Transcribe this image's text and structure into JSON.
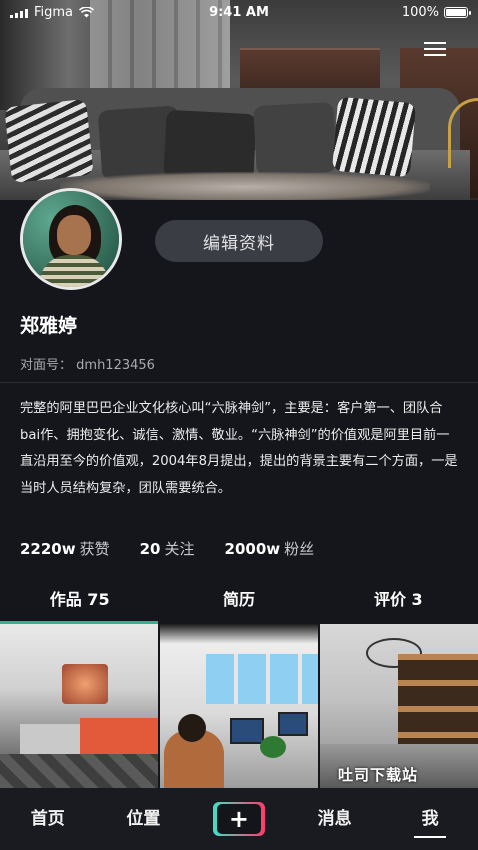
{
  "status_bar": {
    "carrier": "Figma",
    "time": "9:41 AM",
    "battery_text": "100%",
    "battery_level": 1.0
  },
  "profile": {
    "edit_button_label": "编辑资料",
    "name": "郑雅婷",
    "account_label": "对面号：",
    "account_id": "dmh123456",
    "bio": "完整的阿里巴巴企业文化核心叫“六脉神剑”，主要是：客户第一、团队合bai作、拥抱变化、诚信、激情、敬业。“六脉神剑”的价值观是阿里目前一直沿用至今的价值观，2004年8月提出，提出的背景主要有二个方面，一是当时人员结构复杂，团队需要统合。"
  },
  "stats": [
    {
      "value": "2220w",
      "label": "获赞"
    },
    {
      "value": "20",
      "label": "关注"
    },
    {
      "value": "2000w",
      "label": "粉丝"
    }
  ],
  "tabs": [
    {
      "label": "作品 75",
      "active": true
    },
    {
      "label": "简历",
      "active": false
    },
    {
      "label": "评价 3",
      "active": false
    }
  ],
  "grid": {
    "watermark": "吐司下载站"
  },
  "nav": {
    "items": [
      {
        "label": "首页"
      },
      {
        "label": "位置"
      },
      {
        "label": "+"
      },
      {
        "label": "消息"
      },
      {
        "label": "我",
        "active": true
      }
    ]
  },
  "colors": {
    "background": "#15161b",
    "tab_indicator": "#2fb38e",
    "edit_button_bg": "#3b3d45",
    "nav_bg": "#1a1b20"
  }
}
